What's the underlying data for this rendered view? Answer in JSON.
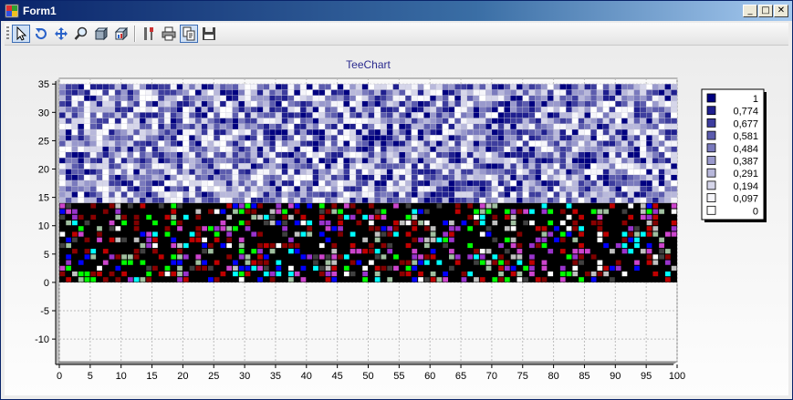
{
  "window": {
    "title": "Form1"
  },
  "titlebar_buttons": {
    "minimize": "_",
    "maximize": "□",
    "close": "✕"
  },
  "toolbar": {
    "buttons": [
      {
        "id": "select",
        "icon": "arrow-pointer-icon",
        "active": true
      },
      {
        "id": "rotate",
        "icon": "rotate-icon",
        "active": false
      },
      {
        "id": "move",
        "icon": "move-icon",
        "active": false
      },
      {
        "id": "zoom",
        "icon": "magnifier-icon",
        "active": false
      },
      {
        "id": "depth",
        "icon": "3d-depth-icon",
        "active": false
      },
      {
        "id": "view3d",
        "icon": "3d-view-icon",
        "active": false
      },
      {
        "id": "edit",
        "icon": "tools-icon",
        "active": false
      },
      {
        "id": "print",
        "icon": "printer-icon",
        "active": false
      },
      {
        "id": "copy",
        "icon": "copy-icon",
        "active": true
      },
      {
        "id": "save",
        "icon": "floppy-disk-icon",
        "active": false
      }
    ]
  },
  "colors": {
    "window_title_start": "#0a246a",
    "heat_low": "#ffffff",
    "heat_high": "#000080",
    "plot_bg": "#f8f8f8"
  },
  "chart_data": {
    "type": "heatmap",
    "title": "TeeChart",
    "x_ticks": [
      "0",
      "5",
      "10",
      "15",
      "20",
      "25",
      "30",
      "35",
      "40",
      "45",
      "50",
      "55",
      "60",
      "65",
      "70",
      "75",
      "80",
      "85",
      "90",
      "95",
      "100"
    ],
    "y_ticks": [
      "35",
      "30",
      "25",
      "20",
      "15",
      "10",
      "5",
      "0",
      "-5",
      "-10"
    ],
    "xlim": [
      0,
      100
    ],
    "ylim": [
      -14,
      36
    ],
    "grid": true,
    "legend_position": "right",
    "legend": [
      "1",
      "0,774",
      "0,677",
      "0,581",
      "0,484",
      "0,387",
      "0,291",
      "0,194",
      "0,097",
      "0"
    ],
    "legend_colors": [
      "#000080",
      "#1f1f8f",
      "#3d3d9e",
      "#5c5cae",
      "#7a7abd",
      "#9999cc",
      "#b8b8db",
      "#d6d6ea",
      "#f5f5fa",
      "#ffffff"
    ],
    "series": [
      {
        "region": "upper",
        "x_range": [
          0,
          100
        ],
        "y_range": [
          14,
          35
        ],
        "cell_size": 1,
        "value_range": [
          0,
          1
        ],
        "palette": "blue-white"
      },
      {
        "region": "lower",
        "x_range": [
          0,
          100
        ],
        "y_range": [
          0,
          14
        ],
        "cell_size": 1,
        "background": "#000000",
        "palette": [
          "#000000",
          "#8b0000",
          "#c00000",
          "#800000",
          "#404040",
          "#c0c0c0",
          "#ffffff",
          "#cc44cc",
          "#9933cc",
          "#00ffff",
          "#00ff00",
          "#0000ff",
          "#a0c0a0"
        ]
      }
    ]
  }
}
